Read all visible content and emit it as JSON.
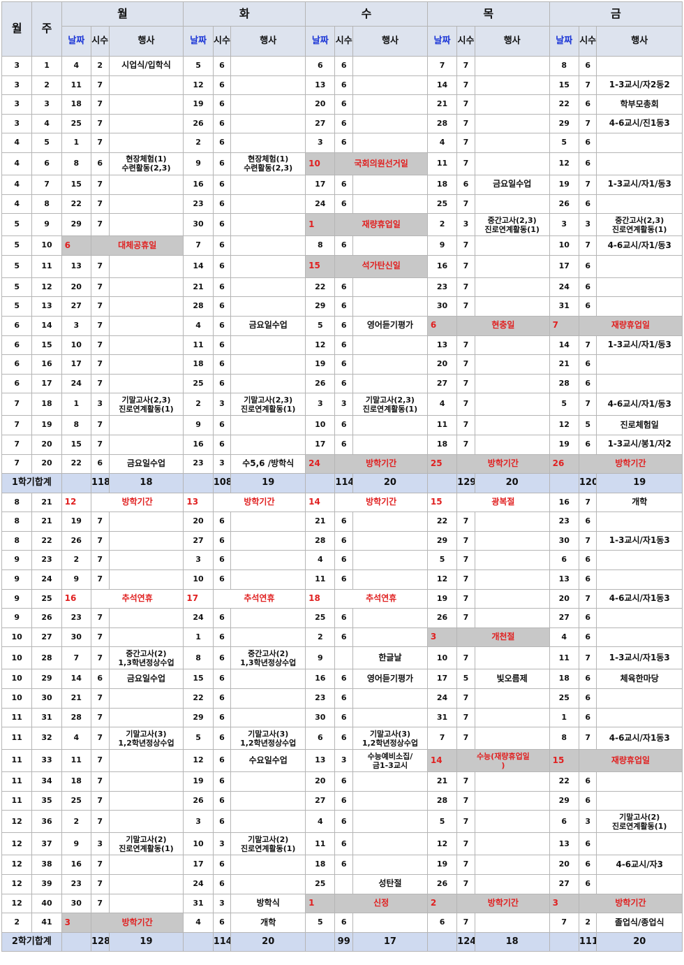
{
  "header": {
    "month": "월",
    "week": "주",
    "days": [
      "월",
      "화",
      "수",
      "목",
      "금"
    ],
    "date": "날짜",
    "hours": "시수",
    "event": "행사"
  },
  "rows": [
    {
      "m": "3",
      "w": "1",
      "c": [
        [
          "4",
          "2",
          "시업식/입학식"
        ],
        [
          "5",
          "6",
          ""
        ],
        [
          "6",
          "6",
          ""
        ],
        [
          "7",
          "7",
          ""
        ],
        [
          "8",
          "6",
          ""
        ]
      ]
    },
    {
      "m": "3",
      "w": "2",
      "c": [
        [
          "11",
          "7",
          ""
        ],
        [
          "12",
          "6",
          ""
        ],
        [
          "13",
          "6",
          ""
        ],
        [
          "14",
          "7",
          ""
        ],
        [
          "15",
          "7",
          "1-3교시/자2동2"
        ]
      ]
    },
    {
      "m": "3",
      "w": "3",
      "c": [
        [
          "18",
          "7",
          ""
        ],
        [
          "19",
          "6",
          ""
        ],
        [
          "20",
          "6",
          ""
        ],
        [
          "21",
          "7",
          ""
        ],
        [
          "22",
          "6",
          "학부모총회"
        ]
      ]
    },
    {
      "m": "3",
      "w": "4",
      "c": [
        [
          "25",
          "7",
          ""
        ],
        [
          "26",
          "6",
          ""
        ],
        [
          "27",
          "6",
          ""
        ],
        [
          "28",
          "7",
          ""
        ],
        [
          "29",
          "7",
          "4-6교시/진1동3"
        ]
      ]
    },
    {
      "m": "4",
      "w": "5",
      "c": [
        [
          "1",
          "7",
          ""
        ],
        [
          "2",
          "6",
          ""
        ],
        [
          "3",
          "6",
          ""
        ],
        [
          "4",
          "7",
          ""
        ],
        [
          "5",
          "6",
          ""
        ]
      ]
    },
    {
      "m": "4",
      "w": "6",
      "tall": true,
      "c": [
        [
          "8",
          "6",
          "현장체험(1)\n수련활동(2,3)"
        ],
        [
          "9",
          "6",
          "현장체험(1)\n수련활동(2,3)"
        ],
        [
          "10",
          "",
          "국회의원선거일",
          "h"
        ],
        [
          "11",
          "7",
          ""
        ],
        [
          "12",
          "6",
          ""
        ]
      ]
    },
    {
      "m": "4",
      "w": "7",
      "c": [
        [
          "15",
          "7",
          ""
        ],
        [
          "16",
          "6",
          ""
        ],
        [
          "17",
          "6",
          ""
        ],
        [
          "18",
          "6",
          "금요일수업"
        ],
        [
          "19",
          "7",
          "1-3교시/자1/동3"
        ]
      ]
    },
    {
      "m": "4",
      "w": "8",
      "c": [
        [
          "22",
          "7",
          ""
        ],
        [
          "23",
          "6",
          ""
        ],
        [
          "24",
          "6",
          ""
        ],
        [
          "25",
          "7",
          ""
        ],
        [
          "26",
          "6",
          ""
        ]
      ]
    },
    {
      "m": "5",
      "w": "9",
      "tall": true,
      "c": [
        [
          "29",
          "7",
          ""
        ],
        [
          "30",
          "6",
          ""
        ],
        [
          "1",
          "",
          "재량휴업일",
          "h"
        ],
        [
          "2",
          "3",
          "중간고사(2,3)\n진로연계활동(1)"
        ],
        [
          "3",
          "3",
          "중간고사(2,3)\n진로연계활동(1)"
        ]
      ]
    },
    {
      "m": "5",
      "w": "10",
      "c": [
        [
          "6",
          "",
          "대체공휴일",
          "h"
        ],
        [
          "7",
          "6",
          ""
        ],
        [
          "8",
          "6",
          ""
        ],
        [
          "9",
          "7",
          ""
        ],
        [
          "10",
          "7",
          "4-6교시/자1/동3"
        ]
      ]
    },
    {
      "m": "5",
      "w": "11",
      "tall": true,
      "c": [
        [
          "13",
          "7",
          ""
        ],
        [
          "14",
          "6",
          ""
        ],
        [
          "15",
          "",
          "석가탄신일",
          "h"
        ],
        [
          "16",
          "7",
          ""
        ],
        [
          "17",
          "6",
          ""
        ]
      ]
    },
    {
      "m": "5",
      "w": "12",
      "c": [
        [
          "20",
          "7",
          ""
        ],
        [
          "21",
          "6",
          ""
        ],
        [
          "22",
          "6",
          ""
        ],
        [
          "23",
          "7",
          ""
        ],
        [
          "24",
          "6",
          ""
        ]
      ]
    },
    {
      "m": "5",
      "w": "13",
      "c": [
        [
          "27",
          "7",
          ""
        ],
        [
          "28",
          "6",
          ""
        ],
        [
          "29",
          "6",
          ""
        ],
        [
          "30",
          "7",
          ""
        ],
        [
          "31",
          "6",
          ""
        ]
      ]
    },
    {
      "m": "6",
      "w": "14",
      "c": [
        [
          "3",
          "7",
          ""
        ],
        [
          "4",
          "6",
          "금요일수업"
        ],
        [
          "5",
          "6",
          "영어듣기평가"
        ],
        [
          "6",
          "",
          "현충일",
          "h"
        ],
        [
          "7",
          "",
          "재량휴업일",
          "h"
        ]
      ]
    },
    {
      "m": "6",
      "w": "15",
      "c": [
        [
          "10",
          "7",
          ""
        ],
        [
          "11",
          "6",
          ""
        ],
        [
          "12",
          "6",
          ""
        ],
        [
          "13",
          "7",
          ""
        ],
        [
          "14",
          "7",
          "1-3교시/자1/동3"
        ]
      ]
    },
    {
      "m": "6",
      "w": "16",
      "c": [
        [
          "17",
          "7",
          ""
        ],
        [
          "18",
          "6",
          ""
        ],
        [
          "19",
          "6",
          ""
        ],
        [
          "20",
          "7",
          ""
        ],
        [
          "21",
          "6",
          ""
        ]
      ]
    },
    {
      "m": "6",
      "w": "17",
      "c": [
        [
          "24",
          "7",
          ""
        ],
        [
          "25",
          "6",
          ""
        ],
        [
          "26",
          "6",
          ""
        ],
        [
          "27",
          "7",
          ""
        ],
        [
          "28",
          "6",
          ""
        ]
      ]
    },
    {
      "m": "7",
      "w": "18",
      "tall": true,
      "c": [
        [
          "1",
          "3",
          "기말고사(2,3)\n진로연계활동(1)"
        ],
        [
          "2",
          "3",
          "기말고사(2,3)\n진로연계활동(1)"
        ],
        [
          "3",
          "3",
          "기말고사(2,3)\n진로연계활동(1)"
        ],
        [
          "4",
          "7",
          ""
        ],
        [
          "5",
          "7",
          "4-6교시/자1/동3"
        ]
      ]
    },
    {
      "m": "7",
      "w": "19",
      "c": [
        [
          "8",
          "7",
          ""
        ],
        [
          "9",
          "6",
          ""
        ],
        [
          "10",
          "6",
          ""
        ],
        [
          "11",
          "7",
          ""
        ],
        [
          "12",
          "5",
          "진로체험일"
        ]
      ]
    },
    {
      "m": "7",
      "w": "20",
      "c": [
        [
          "15",
          "7",
          ""
        ],
        [
          "16",
          "6",
          ""
        ],
        [
          "17",
          "6",
          ""
        ],
        [
          "18",
          "7",
          ""
        ],
        [
          "19",
          "6",
          "1-3교시/봉1/자2"
        ]
      ]
    },
    {
      "m": "7",
      "w": "20",
      "c": [
        [
          "22",
          "6",
          "금요일수업"
        ],
        [
          "23",
          "3",
          "수5,6 /방학식"
        ],
        [
          "24",
          "",
          "방학기간",
          "h"
        ],
        [
          "25",
          "",
          "방학기간",
          "h"
        ],
        [
          "26",
          "",
          "방학기간",
          "h"
        ]
      ]
    },
    {
      "sum": true,
      "label": "1학기합계",
      "c": [
        [
          "118",
          "18"
        ],
        [
          "108",
          "19"
        ],
        [
          "114",
          "20"
        ],
        [
          "129",
          "20"
        ],
        [
          "120",
          "19"
        ]
      ]
    },
    {
      "m": "8",
      "w": "21",
      "c": [
        [
          "12",
          "",
          "방학기간",
          "r"
        ],
        [
          "13",
          "",
          "방학기간",
          "r"
        ],
        [
          "14",
          "",
          "방학기간",
          "r"
        ],
        [
          "15",
          "",
          "광복절",
          "r"
        ],
        [
          "16",
          "7",
          "개학"
        ]
      ]
    },
    {
      "m": "8",
      "w": "21",
      "c": [
        [
          "19",
          "7",
          ""
        ],
        [
          "20",
          "6",
          ""
        ],
        [
          "21",
          "6",
          ""
        ],
        [
          "22",
          "7",
          ""
        ],
        [
          "23",
          "6",
          ""
        ]
      ]
    },
    {
      "m": "8",
      "w": "22",
      "c": [
        [
          "26",
          "7",
          ""
        ],
        [
          "27",
          "6",
          ""
        ],
        [
          "28",
          "6",
          ""
        ],
        [
          "29",
          "7",
          ""
        ],
        [
          "30",
          "7",
          "1-3교시/자1동3"
        ]
      ]
    },
    {
      "m": "9",
      "w": "23",
      "c": [
        [
          "2",
          "7",
          ""
        ],
        [
          "3",
          "6",
          ""
        ],
        [
          "4",
          "6",
          ""
        ],
        [
          "5",
          "7",
          ""
        ],
        [
          "6",
          "6",
          ""
        ]
      ]
    },
    {
      "m": "9",
      "w": "24",
      "c": [
        [
          "9",
          "7",
          ""
        ],
        [
          "10",
          "6",
          ""
        ],
        [
          "11",
          "6",
          ""
        ],
        [
          "12",
          "7",
          ""
        ],
        [
          "13",
          "6",
          ""
        ]
      ]
    },
    {
      "m": "9",
      "w": "25",
      "c": [
        [
          "16",
          "",
          "추석연휴",
          "r"
        ],
        [
          "17",
          "",
          "추석연휴",
          "r"
        ],
        [
          "18",
          "",
          "추석연휴",
          "r"
        ],
        [
          "19",
          "7",
          ""
        ],
        [
          "20",
          "7",
          "4-6교시/자1동3"
        ]
      ]
    },
    {
      "m": "9",
      "w": "26",
      "c": [
        [
          "23",
          "7",
          ""
        ],
        [
          "24",
          "6",
          ""
        ],
        [
          "25",
          "6",
          ""
        ],
        [
          "26",
          "7",
          ""
        ],
        [
          "27",
          "6",
          ""
        ]
      ]
    },
    {
      "m": "10",
      "w": "27",
      "c": [
        [
          "30",
          "7",
          ""
        ],
        [
          "1",
          "6",
          ""
        ],
        [
          "2",
          "6",
          ""
        ],
        [
          "3",
          "",
          "개천절",
          "h"
        ],
        [
          "4",
          "6",
          ""
        ]
      ]
    },
    {
      "m": "10",
      "w": "28",
      "tall": true,
      "c": [
        [
          "7",
          "7",
          "중간고사(2)\n1,3학년정상수업"
        ],
        [
          "8",
          "6",
          "중간고사(2)\n1,3학년정상수업"
        ],
        [
          "9",
          "",
          "한글날"
        ],
        [
          "10",
          "7",
          ""
        ],
        [
          "11",
          "7",
          "1-3교시/자1동3"
        ]
      ]
    },
    {
      "m": "10",
      "w": "29",
      "c": [
        [
          "14",
          "6",
          "금요일수업"
        ],
        [
          "15",
          "6",
          ""
        ],
        [
          "16",
          "6",
          "영어듣기평가"
        ],
        [
          "17",
          "5",
          "빛오름제"
        ],
        [
          "18",
          "6",
          "체육한마당"
        ]
      ]
    },
    {
      "m": "10",
      "w": "30",
      "c": [
        [
          "21",
          "7",
          ""
        ],
        [
          "22",
          "6",
          ""
        ],
        [
          "23",
          "6",
          ""
        ],
        [
          "24",
          "7",
          ""
        ],
        [
          "25",
          "6",
          ""
        ]
      ]
    },
    {
      "m": "11",
      "w": "31",
      "c": [
        [
          "28",
          "7",
          ""
        ],
        [
          "29",
          "6",
          ""
        ],
        [
          "30",
          "6",
          ""
        ],
        [
          "31",
          "7",
          ""
        ],
        [
          "1",
          "6",
          ""
        ]
      ]
    },
    {
      "m": "11",
      "w": "32",
      "tall": true,
      "c": [
        [
          "4",
          "7",
          "기말고사(3)\n1,2학년정상수업"
        ],
        [
          "5",
          "6",
          "기말고사(3)\n1,2학년정상수업"
        ],
        [
          "6",
          "6",
          "기말고사(3)\n1,2학년정상수업"
        ],
        [
          "7",
          "7",
          ""
        ],
        [
          "8",
          "7",
          "4-6교시/자1동3"
        ]
      ]
    },
    {
      "m": "11",
      "w": "33",
      "tall": true,
      "c": [
        [
          "11",
          "7",
          ""
        ],
        [
          "12",
          "6",
          "수요일수업"
        ],
        [
          "13",
          "3",
          "수능예비소집/\n금1-3교시"
        ],
        [
          "14",
          "",
          "수능(재량휴업일\n)",
          "h"
        ],
        [
          "15",
          "",
          "재량휴업일",
          "h"
        ]
      ]
    },
    {
      "m": "11",
      "w": "34",
      "c": [
        [
          "18",
          "7",
          ""
        ],
        [
          "19",
          "6",
          ""
        ],
        [
          "20",
          "6",
          ""
        ],
        [
          "21",
          "7",
          ""
        ],
        [
          "22",
          "6",
          ""
        ]
      ]
    },
    {
      "m": "11",
      "w": "35",
      "c": [
        [
          "25",
          "7",
          ""
        ],
        [
          "26",
          "6",
          ""
        ],
        [
          "27",
          "6",
          ""
        ],
        [
          "28",
          "7",
          ""
        ],
        [
          "29",
          "6",
          ""
        ]
      ]
    },
    {
      "m": "12",
      "w": "36",
      "tall": true,
      "c": [
        [
          "2",
          "7",
          ""
        ],
        [
          "3",
          "6",
          ""
        ],
        [
          "4",
          "6",
          ""
        ],
        [
          "5",
          "7",
          ""
        ],
        [
          "6",
          "3",
          "기말고사(2)\n진로연계활동(1)"
        ]
      ]
    },
    {
      "m": "12",
      "w": "37",
      "tall": true,
      "c": [
        [
          "9",
          "3",
          "기말고사(2)\n진로연계활동(1)"
        ],
        [
          "10",
          "3",
          "기말고사(2)\n진로연계활동(1)"
        ],
        [
          "11",
          "6",
          ""
        ],
        [
          "12",
          "7",
          ""
        ],
        [
          "13",
          "6",
          ""
        ]
      ]
    },
    {
      "m": "12",
      "w": "38",
      "c": [
        [
          "16",
          "7",
          ""
        ],
        [
          "17",
          "6",
          ""
        ],
        [
          "18",
          "6",
          ""
        ],
        [
          "19",
          "7",
          ""
        ],
        [
          "20",
          "6",
          "4-6교시/자3"
        ]
      ]
    },
    {
      "m": "12",
      "w": "39",
      "c": [
        [
          "23",
          "7",
          ""
        ],
        [
          "24",
          "6",
          ""
        ],
        [
          "25",
          "",
          "성탄절"
        ],
        [
          "26",
          "7",
          ""
        ],
        [
          "27",
          "6",
          ""
        ]
      ]
    },
    {
      "m": "12",
      "w": "40",
      "c": [
        [
          "30",
          "7",
          ""
        ],
        [
          "31",
          "3",
          "방학식"
        ],
        [
          "1",
          "",
          "신정",
          "h"
        ],
        [
          "2",
          "",
          "방학기간",
          "h"
        ],
        [
          "3",
          "",
          "방학기간",
          "h"
        ]
      ]
    },
    {
      "m": "2",
      "w": "41",
      "c": [
        [
          "3",
          "",
          "방학기간",
          "h"
        ],
        [
          "4",
          "6",
          "개학"
        ],
        [
          "5",
          "6",
          ""
        ],
        [
          "6",
          "7",
          ""
        ],
        [
          "7",
          "2",
          "졸업식/종업식"
        ]
      ]
    },
    {
      "sum": true,
      "label": "2학기합계",
      "c": [
        [
          "128",
          "19"
        ],
        [
          "114",
          "20"
        ],
        [
          "99",
          "17"
        ],
        [
          "124",
          "18"
        ],
        [
          "111",
          "20"
        ]
      ]
    }
  ],
  "colors": {
    "holiday_text": "#e02020",
    "holiday_bg": "#c8c8c8",
    "header_bg": "#dde3ee",
    "sum_bg": "#cfdaf0",
    "date_header": "#1a35d6"
  }
}
